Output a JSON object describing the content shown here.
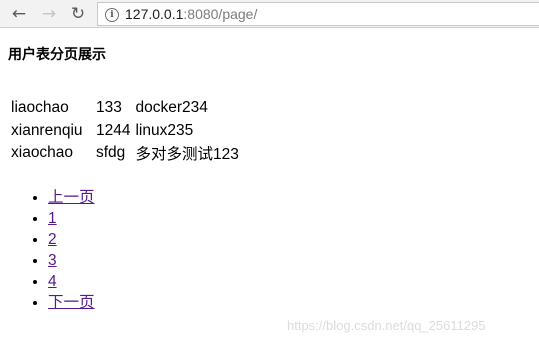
{
  "browser": {
    "url_host": "127.0.0.1",
    "url_rest": ":8080/page/",
    "icons": {
      "back": "back-arrow-icon",
      "forward": "forward-arrow-icon",
      "reload": "reload-icon",
      "info": "info-icon"
    }
  },
  "page": {
    "title": "用户表分页展示",
    "rows": [
      [
        "liaochao",
        "133",
        "docker234"
      ],
      [
        "xianrenqiu",
        "1244",
        "linux235"
      ],
      [
        "xiaochao",
        "sfdg",
        "多对多测试123"
      ]
    ],
    "pager": {
      "prev": "上一页",
      "pages": [
        "1",
        "2",
        "3",
        "4"
      ],
      "next": "下一页"
    }
  },
  "watermark": "https://blog.csdn.net/qq_25611295",
  "colors": {
    "link_visited": "#551a8b",
    "toolbar_bg": "#f2f2f2"
  }
}
